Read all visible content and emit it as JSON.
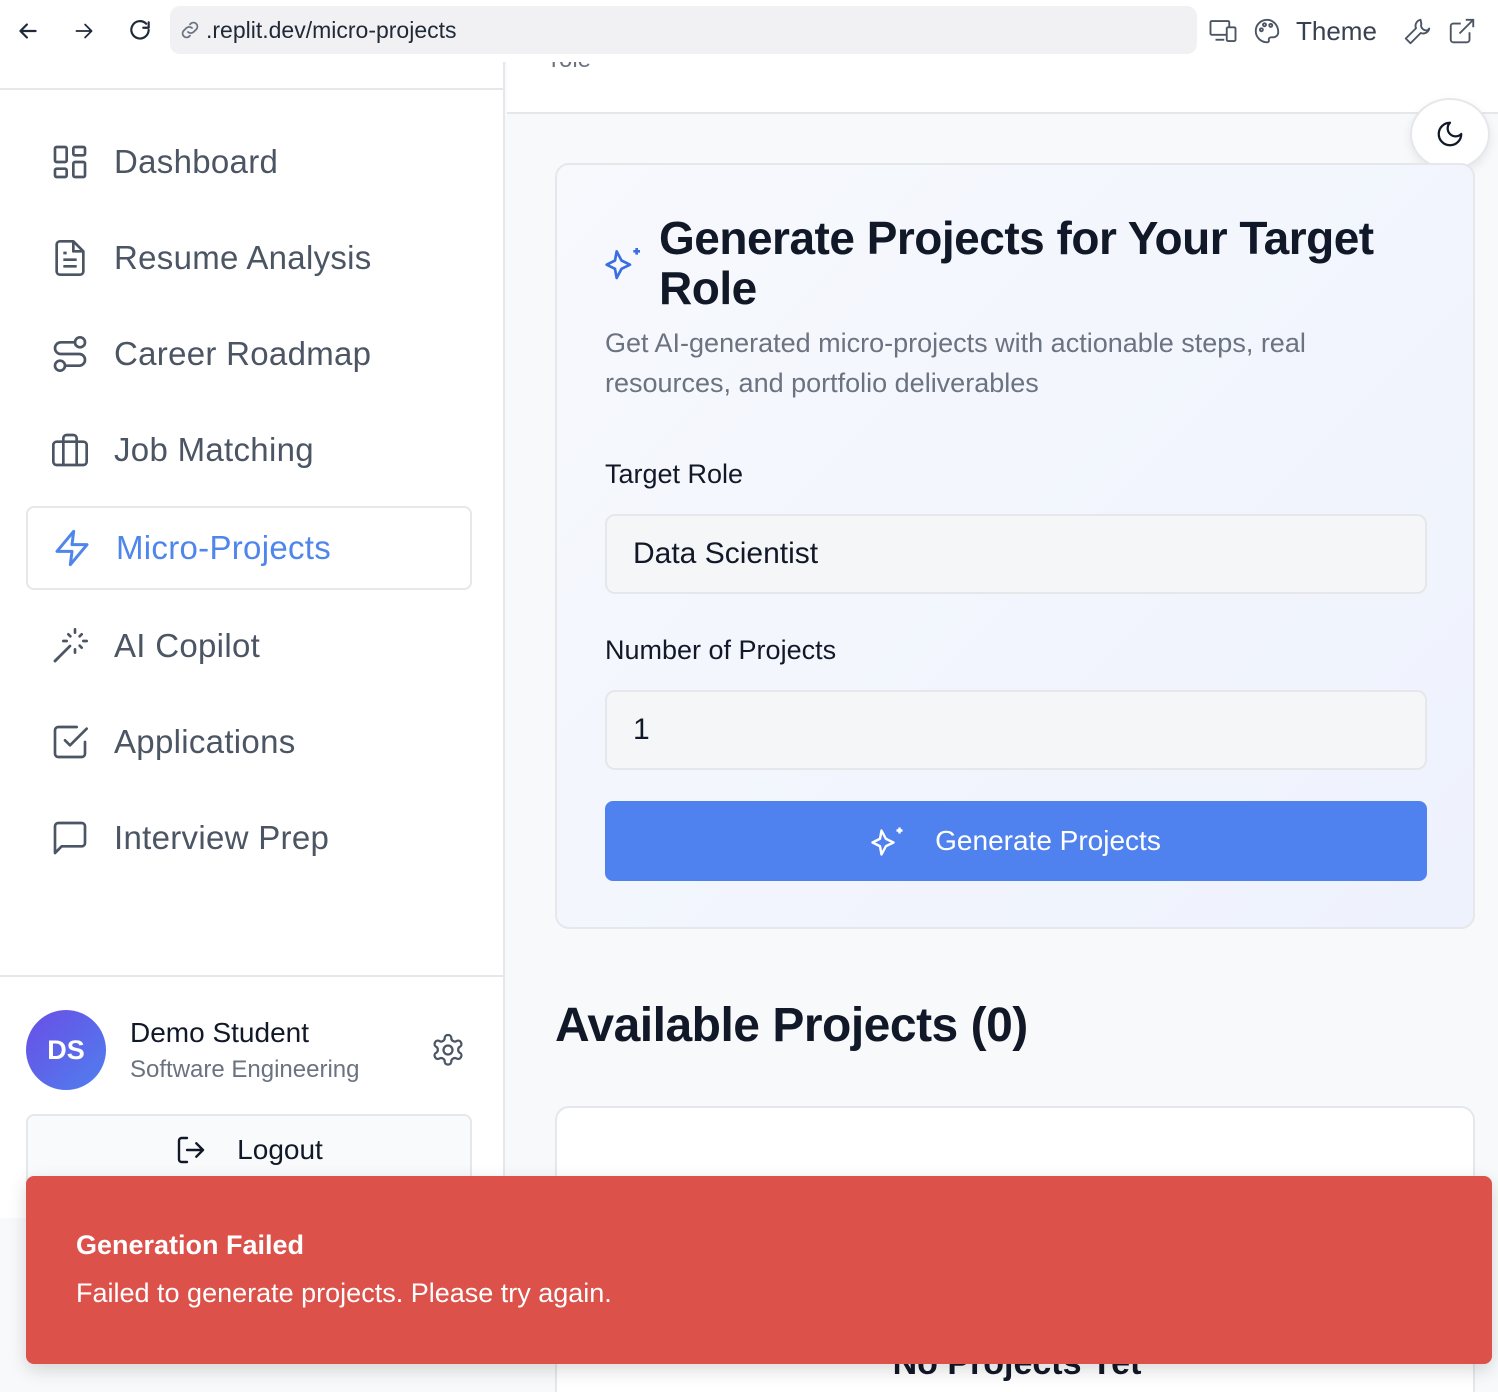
{
  "browser": {
    "url": ".replit.dev/micro-projects",
    "theme_label": "Theme"
  },
  "sidebar": {
    "items": [
      {
        "label": "Dashboard",
        "icon": "dashboard-icon"
      },
      {
        "label": "Resume Analysis",
        "icon": "document-icon"
      },
      {
        "label": "Career Roadmap",
        "icon": "route-icon"
      },
      {
        "label": "Job Matching",
        "icon": "briefcase-icon"
      },
      {
        "label": "Micro-Projects",
        "icon": "lightning-icon",
        "active": true
      },
      {
        "label": "AI Copilot",
        "icon": "magic-wand-icon"
      },
      {
        "label": "Applications",
        "icon": "check-square-icon"
      },
      {
        "label": "Interview Prep",
        "icon": "chat-icon"
      }
    ],
    "user": {
      "initials": "DS",
      "name": "Demo Student",
      "program": "Software Engineering"
    },
    "logout_label": "Logout"
  },
  "main": {
    "header_clipped": "role",
    "generate_card": {
      "title": "Generate Projects for Your Target Role",
      "description": "Get AI-generated micro-projects with actionable steps, real resources, and portfolio deliverables",
      "target_role_label": "Target Role",
      "target_role_value": "Data Scientist",
      "num_projects_label": "Number of Projects",
      "num_projects_value": "1",
      "button_label": "Generate Projects"
    },
    "available_title": "Available Projects (0)",
    "empty_title": "No Projects Yet"
  },
  "toast": {
    "title": "Generation Failed",
    "message": "Failed to generate projects. Please try again."
  },
  "colors": {
    "accent": "#4f82ee",
    "active_nav": "#4f86ec",
    "toast_bg": "#dc514a"
  }
}
